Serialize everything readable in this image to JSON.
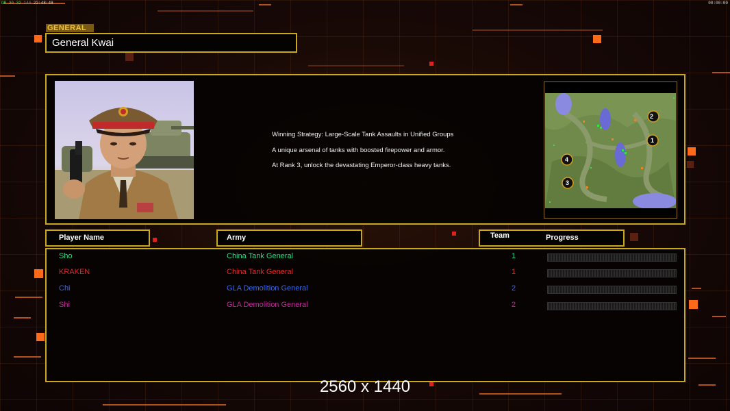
{
  "status": {
    "left_prefix": "DR",
    "left_values": "30 32",
    "left_mid": "144",
    "left_time": "22:48:48",
    "right_time": "00:00:00"
  },
  "general": {
    "tag": "GENERAL",
    "name": "General Kwai"
  },
  "description": [
    "Winning Strategy: Large-Scale Tank Assaults in Unified Groups",
    "A unique arsenal of tanks with boosted firepower and armor.",
    "At Rank 3, unlock the devastating Emperor-class heavy tanks."
  ],
  "minimap": {
    "start_positions": [
      "1",
      "2",
      "3",
      "4"
    ]
  },
  "headers": {
    "player_name": "Player Name",
    "army": "Army",
    "team": "Team",
    "progress": "Progress"
  },
  "players": [
    {
      "name": "Sho",
      "army": "China Tank General",
      "team": "1",
      "color": "#2fd88a",
      "progress": 0
    },
    {
      "name": "KRAKEN",
      "army": "China Tank General",
      "team": "1",
      "color": "#e02828",
      "progress": 0
    },
    {
      "name": "Chi",
      "army": "GLA Demolition General",
      "team": "2",
      "color": "#3a6ae8",
      "progress": 0
    },
    {
      "name": "Shi",
      "army": "GLA Demolition General",
      "team": "2",
      "color": "#c02a9a",
      "progress": 0
    }
  ],
  "watermark": "2560 x 1440",
  "colors": {
    "frame": "#c9a81c",
    "accent": "#ff6a1a"
  }
}
